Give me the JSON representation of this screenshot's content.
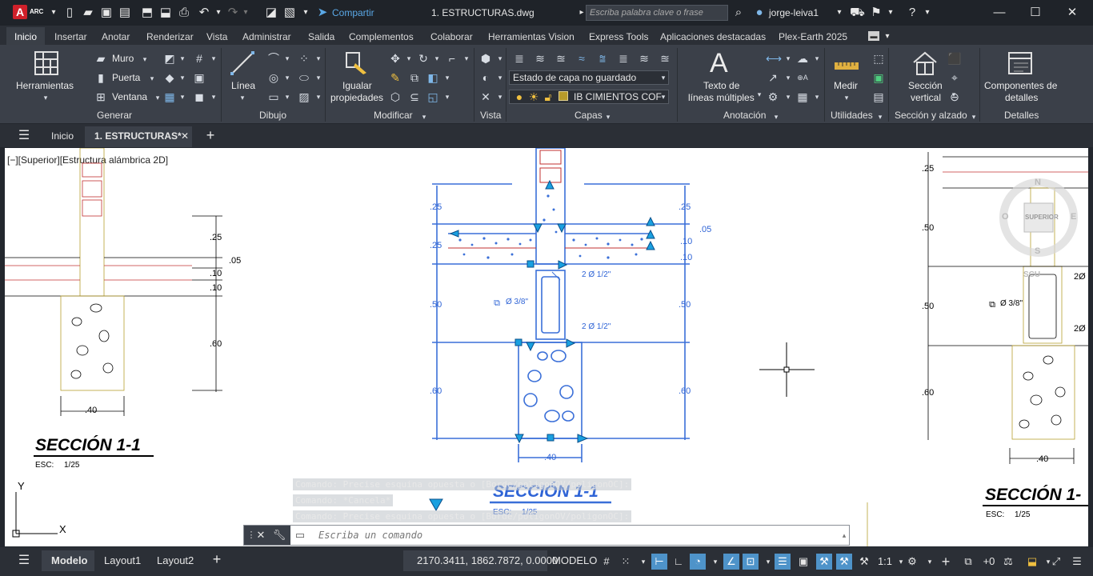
{
  "titlebar": {
    "app_badge": "A",
    "app_badge_sub": "ARC",
    "share_label": "Compartir",
    "file_title": "1. ESTRUCTURAS.dwg",
    "search_placeholder": "Escriba palabra clave o frase",
    "user": "jorge-leiva1"
  },
  "ribbon_tabs": [
    "Inicio",
    "Insertar",
    "Anotar",
    "Renderizar",
    "Vista",
    "Administrar",
    "Salida",
    "Complementos",
    "Colaborar",
    "Herramientas Vision",
    "Express Tools",
    "Aplicaciones destacadas",
    "Plex-Earth 2025"
  ],
  "ribbon": {
    "generar": {
      "label": "Generar",
      "herramientas": "Herramientas",
      "muro": "Muro",
      "puerta": "Puerta",
      "ventana": "Ventana"
    },
    "dibujo": {
      "label": "Dibujo",
      "linea": "Línea"
    },
    "modificar": {
      "label": "Modificar",
      "igualar_1": "Igualar",
      "igualar_2": "propiedades"
    },
    "vista": {
      "label": "Vista"
    },
    "capas": {
      "label": "Capas",
      "layer_state": "Estado de capa no guardado",
      "layer_name": "IB CIMIENTOS COF"
    },
    "anotacion": {
      "label": "Anotación",
      "texto_1": "Texto de",
      "texto_2": "líneas múltiples"
    },
    "utilidades": {
      "label": "Utilidades",
      "medir": "Medir"
    },
    "seccion": {
      "label": "Sección y alzado",
      "sec_1": "Sección",
      "sec_2": "vertical"
    },
    "detalles": {
      "label": "Detalles",
      "comp_1": "Componentes de",
      "comp_2": "detalles"
    }
  },
  "doc_tabs": {
    "home": "Inicio",
    "active": "1. ESTRUCTURAS*"
  },
  "viewport_label": "[−][Superior][Estructura alámbrica 2D]",
  "drawing": {
    "dims_left": [
      ".25",
      ".05",
      ".10",
      ".10",
      ".60",
      ".40"
    ],
    "dims_center_left": [
      ".25",
      ".25",
      ".50",
      ".60"
    ],
    "dims_center_right": [
      ".25",
      ".05",
      ".10",
      ".10",
      ".50",
      ".60"
    ],
    "rebar_top": "2 Ø 1/2\"",
    "rebar_bottom": "2 Ø 1/2\"",
    "stirrup": "Ø 3/8\"",
    "width_center": ".40",
    "dims_right": [
      ".25",
      ".50",
      ".50",
      ".60"
    ],
    "width_right": ".40",
    "rebar_right_1": "2Ø",
    "rebar_right_2": "2Ø",
    "stirrup_right": "Ø 3/8\"",
    "section_title": "SECCIÓN 1-1",
    "scale_label": "ESC:",
    "scale_value": "1/25",
    "section_title_right": "SECCIÓN 1-",
    "viewcube": {
      "n": "N",
      "s": "S",
      "o": "O",
      "e": "E",
      "top": "SUPERIOR",
      "scu": "SCU"
    },
    "ucs_y": "Y",
    "ucs_x": "X"
  },
  "command": {
    "history": [
      "Comando: Precise esquina opuesta o [Borde/poligonOV/poligonOC]:",
      "Comando: *Cancela*",
      "Comando: Precise esquina opuesta o [Borde/poligonOV/poligonOC]:"
    ],
    "placeholder": "Escriba un comando"
  },
  "status": {
    "model_tab": "Modelo",
    "layout1": "Layout1",
    "layout2": "Layout2",
    "coords": "2170.3411, 1862.7872, 0.0000",
    "mode": "MODELO",
    "scale": "1:1",
    "plus_zero": "+0"
  },
  "colors": {
    "accent": "#4e93c9",
    "selection": "#2f64d6",
    "logo": "#d0202a"
  }
}
